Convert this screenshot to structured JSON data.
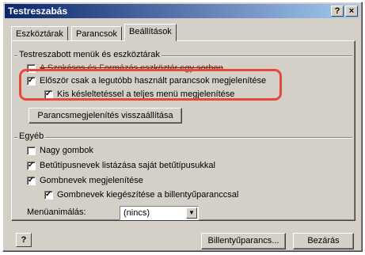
{
  "window": {
    "title": "Testreszabás",
    "help_button": "?",
    "close_button": "×"
  },
  "tabs": [
    {
      "label": "Eszköztárak",
      "active": false
    },
    {
      "label": "Parancsok",
      "active": false
    },
    {
      "label": "Beállítások",
      "active": true
    }
  ],
  "menus_group": {
    "label": "Testreszabott menük és eszköztárak",
    "options": [
      {
        "label": "A Szokásos és Formázás eszköztár egy sorban",
        "checked": false,
        "struck": true
      },
      {
        "label": "Először csak a legutóbb használt parancsok megjelenítése",
        "checked": true
      },
      {
        "label": "Kis késleltetéssel a teljes menü megjelenítése",
        "checked": true
      }
    ],
    "reset_button": "Parancsmegjelenítés visszaállítása"
  },
  "other_group": {
    "label": "Egyéb",
    "options": [
      {
        "label": "Nagy gombok",
        "checked": false
      },
      {
        "label": "Betűtípusnevek listázása saját betűtípusukkal",
        "checked": true
      },
      {
        "label": "Gombnevek megjelenítése",
        "checked": true
      },
      {
        "label": "Gombnevek kiegészítése a billentyűparanccsal",
        "checked": true
      }
    ],
    "animation_label": "Menüanimálás:",
    "animation_value": "(nincs)"
  },
  "footer": {
    "shortcut_button": "Billentyűparancs...",
    "close_button": "Bezárás"
  },
  "colors": {
    "highlight": "#e8483a",
    "titlebar_start": "#0a246a",
    "titlebar_end": "#a6caf0"
  }
}
